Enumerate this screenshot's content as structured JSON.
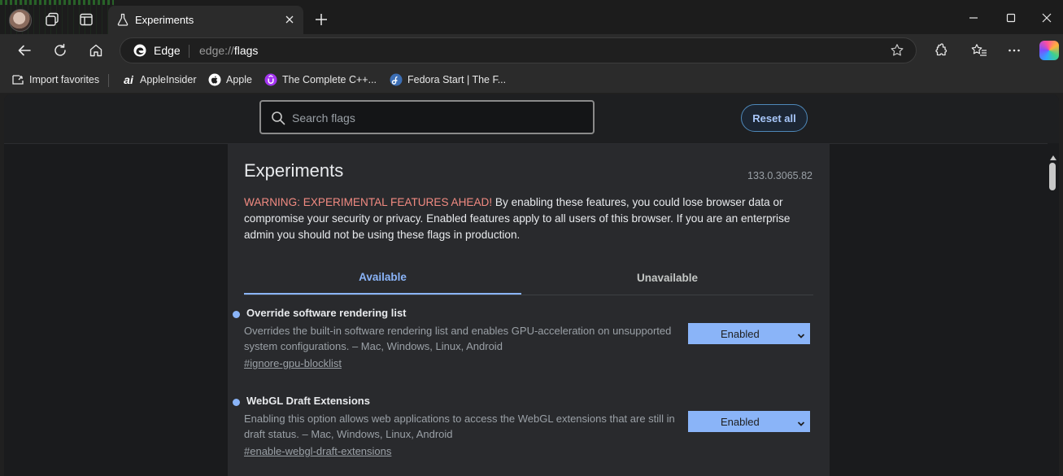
{
  "browser": {
    "active_tab_title": "Experiments",
    "omnibox": {
      "site": "Edge",
      "url_prefix": "edge://",
      "url_path": "flags"
    },
    "favorites": [
      {
        "label": "Import favorites",
        "icon": "import-favorites-icon"
      },
      {
        "label": "AppleInsider",
        "icon": "appleinsider-icon"
      },
      {
        "label": "Apple",
        "icon": "apple-icon"
      },
      {
        "label": "The Complete C++...",
        "icon": "udemy-icon"
      },
      {
        "label": "Fedora Start | The F...",
        "icon": "fedora-icon"
      }
    ]
  },
  "header": {
    "search_placeholder": "Search flags",
    "reset_label": "Reset all"
  },
  "main": {
    "title": "Experiments",
    "version": "133.0.3065.82",
    "warning_strong": "WARNING: EXPERIMENTAL FEATURES AHEAD!",
    "warning_text": " By enabling these features, you could lose browser data or compromise your security or privacy. Enabled features apply to all users of this browser. If you are an enterprise admin you should not be using these flags in production.",
    "tabs": {
      "available": "Available",
      "unavailable": "Unavailable"
    },
    "flags": [
      {
        "name": "Override software rendering list",
        "description": "Overrides the built-in software rendering list and enables GPU-acceleration on unsupported system configurations. – Mac, Windows, Linux, Android",
        "link": "#ignore-gpu-blocklist",
        "value": "Enabled"
      },
      {
        "name": "WebGL Draft Extensions",
        "description": "Enabling this option allows web applications to access the WebGL extensions that are still in draft status. – Mac, Windows, Linux, Android",
        "link": "#enable-webgl-draft-extensions",
        "value": "Enabled"
      }
    ]
  },
  "colors": {
    "accent": "#8ab4f8",
    "warning": "#f28b82",
    "panel": "#292a2d",
    "background": "#1a1b1d"
  }
}
